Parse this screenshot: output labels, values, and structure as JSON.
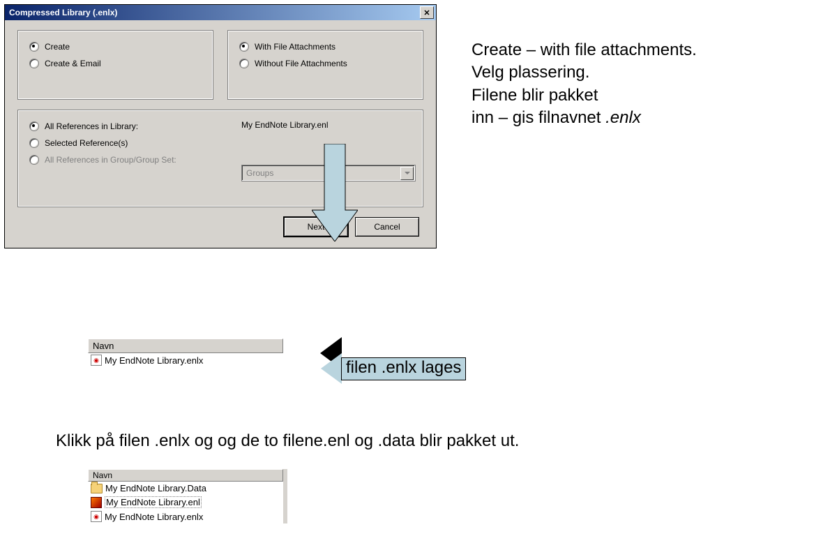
{
  "dialog": {
    "title": "Compressed Library (.enlx)",
    "radios": {
      "create": "Create",
      "create_email": "Create & Email",
      "with_attach": "With File Attachments",
      "without_attach": "Without File Attachments",
      "all_refs": "All References in Library:",
      "selected_refs": "Selected Reference(s)",
      "group_refs": "All References in Group/Group Set:"
    },
    "library_name": "My EndNote Library.enl",
    "groups_dropdown": "Groups",
    "buttons": {
      "next": "Next",
      "cancel": "Cancel"
    }
  },
  "instructions": {
    "line1": "Create – with file attachments.",
    "line2": "Velg plassering.",
    "line3": "Filene blir pakket",
    "line4a": "inn – gis filnavnet ",
    "line4b_italic": ".enlx"
  },
  "filelist1": {
    "header": "Navn",
    "file": "My EndNote Library.enlx"
  },
  "callout_left": "filen .enlx lages",
  "middle_sentence": "Klikk på filen .enlx og og de to filene.enl og .data blir pakket ut.",
  "filelist2": {
    "header": "Navn",
    "items": [
      "My EndNote Library.Data",
      "My EndNote Library.enl",
      "My EndNote Library.enlx"
    ]
  },
  "colors": {
    "arrow_fill": "#b9d4de",
    "arrow_stroke": "#000000"
  }
}
